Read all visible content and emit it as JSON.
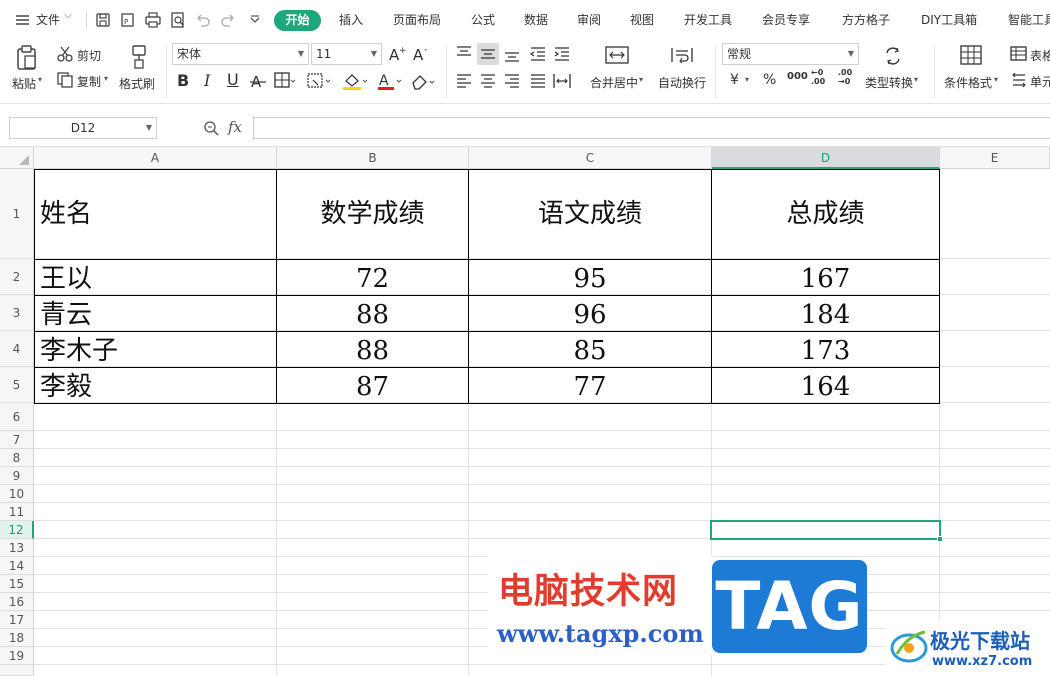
{
  "menubar": {
    "file_label": "文件",
    "tabs": [
      "开始",
      "插入",
      "页面布局",
      "公式",
      "数据",
      "审阅",
      "视图",
      "开发工具",
      "会员专享",
      "方方格子",
      "DIY工具箱",
      "智能工具"
    ]
  },
  "ribbon": {
    "paste": "粘贴",
    "cut": "剪切",
    "copy": "复制",
    "format_painter": "格式刷",
    "font_name": "宋体",
    "font_size": "11",
    "bold": "B",
    "italic": "I",
    "underline": "U",
    "merge_center": "合并居中",
    "wrap_text": "自动换行",
    "number_format": "常规",
    "currency": "¥",
    "percent": "%",
    "thousands": "000",
    "inc_decimal": "←0\n.00",
    "dec_decimal": ".00\n→0",
    "type_convert": "类型转换",
    "cond_format": "条件格式",
    "table_style": "表格",
    "cell": "单元"
  },
  "formula_bar": {
    "name_box": "D12",
    "fx": "fx",
    "formula": ""
  },
  "sheet": {
    "columns": [
      "A",
      "B",
      "C",
      "D",
      "E"
    ],
    "rows": [
      "1",
      "2",
      "3",
      "4",
      "5",
      "6",
      "7",
      "8",
      "9",
      "10",
      "11",
      "12",
      "13",
      "14",
      "15",
      "16",
      "17",
      "18",
      "19"
    ],
    "selected_cell": "D12",
    "table": {
      "headers": [
        "姓名",
        "数学成绩",
        "语文成绩",
        "总成绩"
      ],
      "rows": [
        [
          "王以",
          "72",
          "95",
          "167"
        ],
        [
          "青云",
          "88",
          "96",
          "184"
        ],
        [
          "李木子",
          "88",
          "85",
          "173"
        ],
        [
          "李毅",
          "87",
          "77",
          "164"
        ]
      ]
    }
  },
  "watermark": {
    "title": "电脑技术网",
    "url": "www.tagxp.com",
    "tag": "TAG",
    "xz7_title": "极光下载站",
    "xz7_url": "www.xz7.com"
  },
  "colors": {
    "accent": "#1fa67a",
    "watermark_red": "#e23c2e",
    "watermark_blue": "#2b61c7",
    "tag_blue": "#1d7bd6"
  }
}
